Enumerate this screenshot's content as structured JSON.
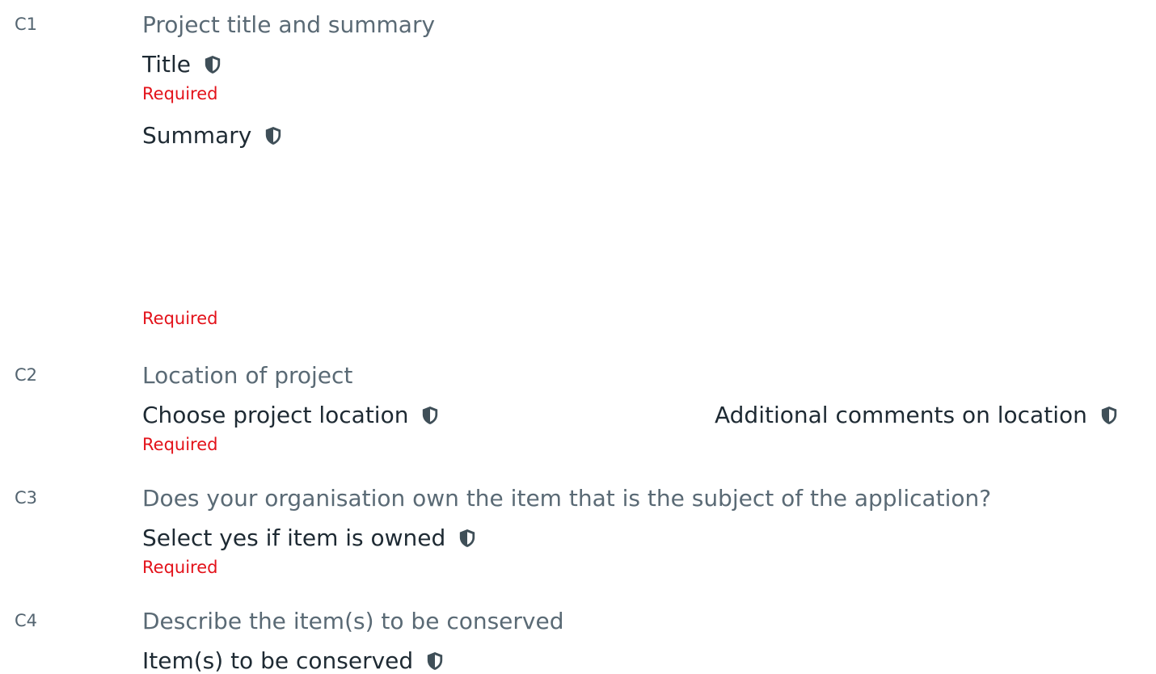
{
  "colors": {
    "section_number": "#536470",
    "section_title": "#5a6a75",
    "label": "#1e2a33",
    "required": "#e3121a",
    "shield_icon": "#3f4f58"
  },
  "sections": [
    {
      "number": "C1",
      "title": "Project title and summary",
      "fields": [
        {
          "label": "Title",
          "icon": "shield-icon",
          "required": "Required"
        },
        {
          "label": "Summary",
          "icon": "shield-icon",
          "required": "Required"
        }
      ]
    },
    {
      "number": "C2",
      "title": "Location of project",
      "fields": [
        {
          "label": "Choose project location",
          "icon": "shield-icon",
          "required": "Required"
        },
        {
          "label": "Additional comments on location",
          "icon": "shield-icon"
        }
      ]
    },
    {
      "number": "C3",
      "title": "Does your organisation own the item that is the subject of the application?",
      "fields": [
        {
          "label": "Select yes if item is owned",
          "icon": "shield-icon",
          "required": "Required"
        }
      ]
    },
    {
      "number": "C4",
      "title": "Describe the item(s) to be conserved",
      "fields": [
        {
          "label": "Item(s) to be conserved",
          "icon": "shield-icon"
        }
      ]
    }
  ]
}
